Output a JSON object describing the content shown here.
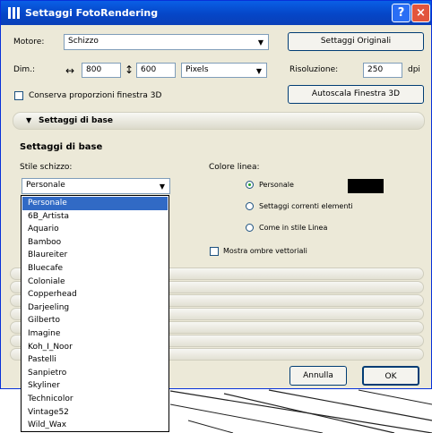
{
  "window": {
    "title": "Settaggi FotoRendering",
    "help": "?",
    "close": "×"
  },
  "engine": {
    "label": "Motore:",
    "value": "Schizzo",
    "original_button": "Settaggi Originali"
  },
  "dimensions": {
    "label": "Dim.:",
    "width": "800",
    "height": "600",
    "unit": "Pixels",
    "width_symbol": "↔",
    "height_symbol": "↕",
    "resolution_label": "Risoluzione:",
    "resolution": "250",
    "resolution_unit": "dpi",
    "keep_proportions": "Conserva proporzioni finestra 3D",
    "autoscale_button": "Autoscala Finestra 3D"
  },
  "section": {
    "bar_label": "Settaggi di base",
    "heading": "Settaggi di base"
  },
  "sketch": {
    "style_label": "Stile schizzo:",
    "style_value": "Personale",
    "options": [
      "Personale",
      "6B_Artista",
      "Aquario",
      "Bamboo",
      "Blaureiter",
      "Bluecafe",
      "Coloniale",
      "Copperhead",
      "Darjeeling",
      "Gilberto",
      "Imagine",
      "Koh_I_Noor",
      "Pastelli",
      "Sanpietro",
      "Skyliner",
      "Technicolor",
      "Vintage52",
      "Wild_Wax"
    ],
    "selected_index": 0
  },
  "line_color": {
    "label": "Colore linea:",
    "options": [
      "Personale",
      "Settaggi correnti elementi",
      "Come in stile Linea"
    ],
    "selected_index": 0,
    "swatch_color": "#000000",
    "vector_shadows": "Mostra ombre vettoriali"
  },
  "footer": {
    "cancel": "Annulla",
    "ok": "OK"
  }
}
